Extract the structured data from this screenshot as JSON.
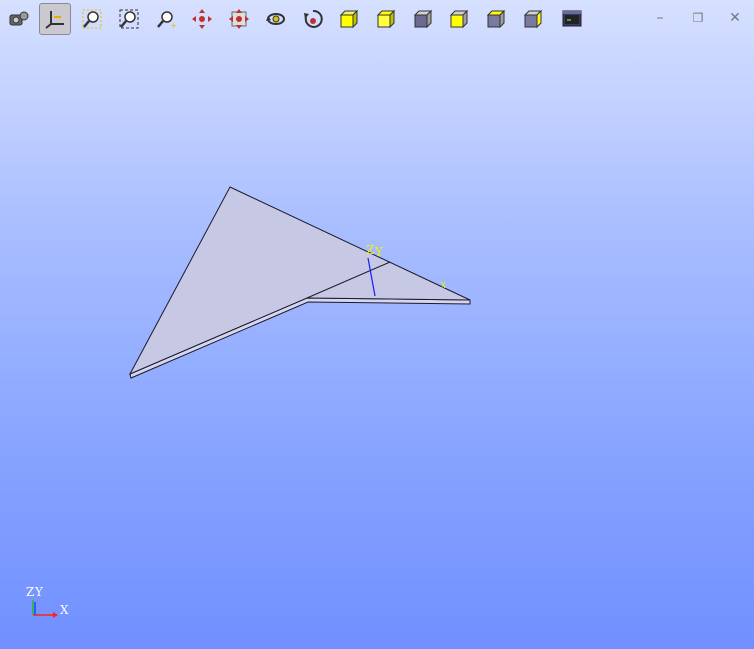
{
  "window": {
    "controls": [
      "minimize",
      "restore",
      "close"
    ],
    "minimize_glyph": "–",
    "restore_glyph": "❐",
    "close_glyph": "✕"
  },
  "toolbar": {
    "buttons": [
      {
        "icon": "camera-icon",
        "active": false
      },
      {
        "icon": "axis-triad-icon",
        "active": true
      },
      {
        "icon": "zoom-window-icon",
        "active": false
      },
      {
        "icon": "zoom-fit-icon",
        "active": false
      },
      {
        "icon": "zoom-icon",
        "active": false
      },
      {
        "icon": "pan-icon",
        "active": false
      },
      {
        "icon": "global-pan-icon",
        "active": false
      },
      {
        "icon": "rotate-icon",
        "active": false
      },
      {
        "icon": "reset-view-icon",
        "active": false
      },
      {
        "icon": "view-front-icon",
        "active": false
      },
      {
        "icon": "view-back-icon",
        "active": false
      },
      {
        "icon": "view-left-icon",
        "active": false
      },
      {
        "icon": "view-right-icon",
        "active": false
      },
      {
        "icon": "view-top-icon",
        "active": false
      },
      {
        "icon": "view-bottom-icon",
        "active": false
      },
      {
        "icon": "presentation-icon",
        "active": false
      }
    ]
  },
  "scene": {
    "shape_axis_label_z": "Z",
    "shape_axis_label_y": "Y",
    "shape_axis_label_x": "X",
    "colors": {
      "face": "#c6c8e4",
      "edge": "#1a1a2e",
      "axis_label": "#f0f000",
      "axis_z": "#1a1aff"
    }
  },
  "triad": {
    "label_z": "Z",
    "label_y": "Y",
    "label_x": "X",
    "colors": {
      "x": "#ff2020",
      "y": "#20c020",
      "z": "#2040ff",
      "text": "#ffffff"
    }
  }
}
